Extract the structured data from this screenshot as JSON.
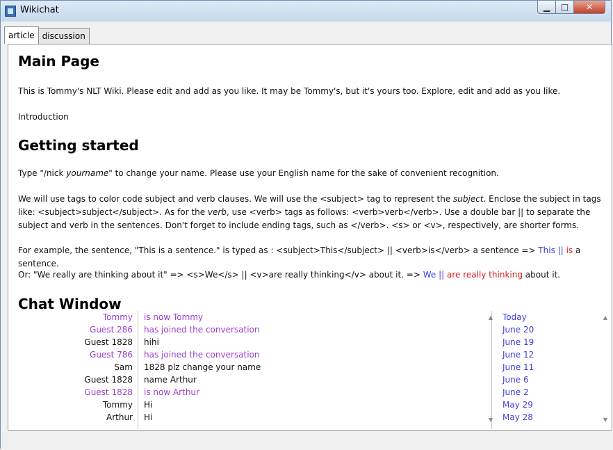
{
  "window": {
    "title": "Wikichat"
  },
  "tabs": [
    {
      "label": "article"
    },
    {
      "label": "discussion"
    }
  ],
  "article": {
    "heading_main": "Main Page",
    "intro_text": "This is Tommy's NLT Wiki. Please edit and add as you like. It may be Tommy's, but it's yours too. Explore, edit and add as you like.",
    "introduction_label": "Introduction",
    "heading_getting_started": "Getting started",
    "nick_pre": "Type \"/nick ",
    "nick_italic": "yourname",
    "nick_post": "\" to change your name. Please use your English name for the sake of convenient recognition.",
    "tags_paragraph_1": "We will use tags to color code subject and verb clauses. We will use the <subject> tag to represent the ",
    "tags_subject_italic": "subject",
    "tags_paragraph_2": ". Enclose the subject in tags like: <subject>subject</subject>. As for the ",
    "tags_verb_italic": "verb",
    "tags_paragraph_3": ", use <verb> tags as follows: <verb>verb</verb>. Use a double bar || to separate the subject and verb in the sentences. Don't forget to include ending tags, such as </verb>. <s> or <v>, respectively, are shorter forms.",
    "example1_pre": "For example, the sentence, \"This is a sentence.\" is typed as : <subject>This</subject> || <verb>is</verb> a sentence => ",
    "example1_subject": "This",
    "example1_bar": " || ",
    "example1_verb": "is",
    "example1_post": " a sentence.",
    "example2_pre": "Or: \"We really are thinking about it\" => <s>We</s> || <v>are really thinking</v> about it. => ",
    "example2_subject": "We",
    "example2_bar": " || ",
    "example2_verb": "are really thinking",
    "example2_post": " about it.",
    "heading_chat": "Chat Window"
  },
  "chat": {
    "messages": [
      {
        "name": "Tommy",
        "text": "is now Tommy",
        "style": "purple"
      },
      {
        "name": "Guest 286",
        "text": "has joined the conversation",
        "style": "purple"
      },
      {
        "name": "Guest 1828",
        "text": "hihi",
        "style": "black"
      },
      {
        "name": "Guest 786",
        "text": "has joined the conversation",
        "style": "purple"
      },
      {
        "name": "Sam",
        "text": "1828 plz change your name",
        "style": "black"
      },
      {
        "name": "Guest 1828",
        "text": "name Arthur",
        "style": "black"
      },
      {
        "name": "Guest 1828",
        "text": "is now Arthur",
        "style": "purple"
      },
      {
        "name": "Tommy",
        "text": "Hi",
        "style": "black"
      },
      {
        "name": "Arthur",
        "text": "Hi",
        "style": "black"
      }
    ],
    "dates": [
      "Today",
      "June 20",
      "June 19",
      "June 12",
      "June 11",
      "June 6",
      "June 2",
      "May 29",
      "May 28"
    ]
  },
  "icons": {
    "scroll_up": "up-arrow-icon",
    "scroll_down": "down-arrow-icon"
  },
  "colors": {
    "subject_blue": "#3b3fd6",
    "verb_red": "#d31e1e",
    "system_purple": "#9b3fd1",
    "close_button": "#c4412a"
  }
}
